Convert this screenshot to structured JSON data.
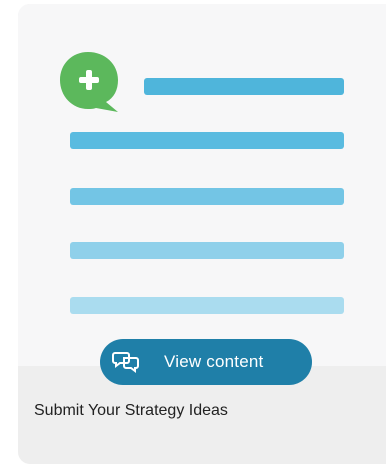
{
  "card": {
    "title": "Submit Your Strategy Ideas",
    "button_label": "View content",
    "button_icon": "chat-bubbles-icon",
    "illustration_icon": "chat-plus-icon"
  },
  "colors": {
    "card_bg": "#eeeeee",
    "illustration_bg": "#f7f7f8",
    "button_bg": "#1f7fa8",
    "plus_bubble": "#5cb85c",
    "lines": [
      "#4fb5db",
      "#5abbe0",
      "#73c5e5",
      "#8fd0ea",
      "#aadcef"
    ]
  }
}
